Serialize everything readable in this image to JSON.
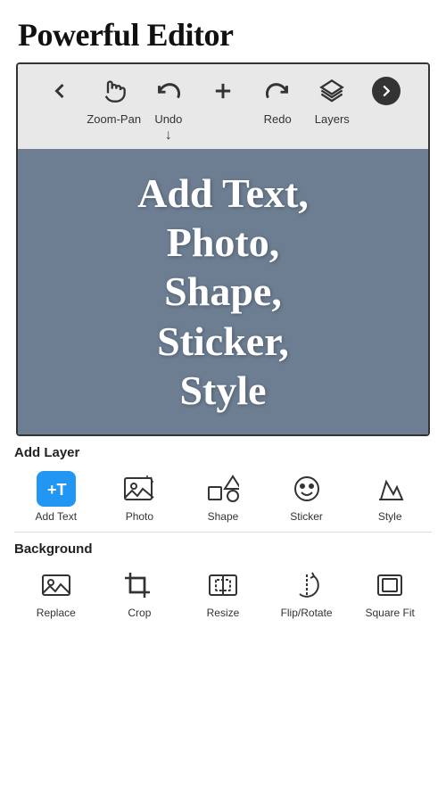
{
  "page": {
    "title": "Powerful Editor"
  },
  "toolbar": {
    "icons": [
      {
        "name": "back-arrow",
        "symbol": "←",
        "label": ""
      },
      {
        "name": "hand-pan",
        "symbol": "✋",
        "label": "Zoom-Pan"
      },
      {
        "name": "undo",
        "symbol": "↩",
        "label": "Undo"
      },
      {
        "name": "add-layer",
        "symbol": "+",
        "label": ""
      },
      {
        "name": "redo",
        "symbol": "↪",
        "label": "Redo"
      },
      {
        "name": "layers",
        "symbol": "⊞",
        "label": "Layers"
      },
      {
        "name": "next-arrow",
        "symbol": "→",
        "label": ""
      }
    ]
  },
  "canvas": {
    "text": "Add Text, Photo, Shape, Sticker, Style",
    "background_color": "#6d7e93"
  },
  "add_layer_section": {
    "title": "Add Layer",
    "items": [
      {
        "name": "add-text",
        "label": "Add Text",
        "icon_type": "blue_plus_t"
      },
      {
        "name": "photo",
        "label": "Photo",
        "icon_type": "photo"
      },
      {
        "name": "shape",
        "label": "Shape",
        "icon_type": "shape"
      },
      {
        "name": "sticker",
        "label": "Sticker",
        "icon_type": "sticker"
      },
      {
        "name": "style",
        "label": "Style",
        "icon_type": "style"
      }
    ]
  },
  "background_section": {
    "title": "Background",
    "items": [
      {
        "name": "replace",
        "label": "Replace",
        "icon_type": "replace"
      },
      {
        "name": "crop",
        "label": "Crop",
        "icon_type": "crop"
      },
      {
        "name": "resize",
        "label": "Resize",
        "icon_type": "resize"
      },
      {
        "name": "flip-rotate",
        "label": "Flip/Rotate",
        "icon_type": "fliprotate"
      },
      {
        "name": "square-fit",
        "label": "Square Fit",
        "icon_type": "squarefit"
      }
    ]
  }
}
